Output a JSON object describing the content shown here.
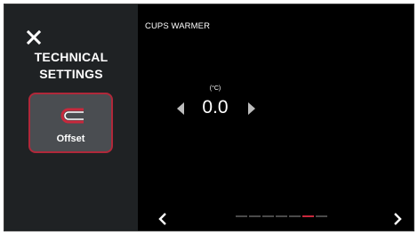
{
  "sidebar": {
    "title_line1": "TECHNICAL",
    "title_line2": "SETTINGS",
    "close_icon": "close-icon",
    "offset_button": {
      "label": "Offset",
      "icon": "offset-icon",
      "selected": true
    }
  },
  "main": {
    "title": "CUPS WARMER",
    "unit": "(°C)",
    "value": "0.0",
    "decrease_icon": "triangle-left-icon",
    "increase_icon": "triangle-right-icon"
  },
  "pagination": {
    "prev_icon": "chevron-left-icon",
    "next_icon": "chevron-right-icon",
    "page_count": 7,
    "active_index": 5
  },
  "colors": {
    "background": "#000000",
    "sidebar": "#1f2224",
    "button": "#4a4d51",
    "accent": "#c8283c",
    "text": "#ffffff",
    "inactive_dot": "#4a4a4a"
  }
}
